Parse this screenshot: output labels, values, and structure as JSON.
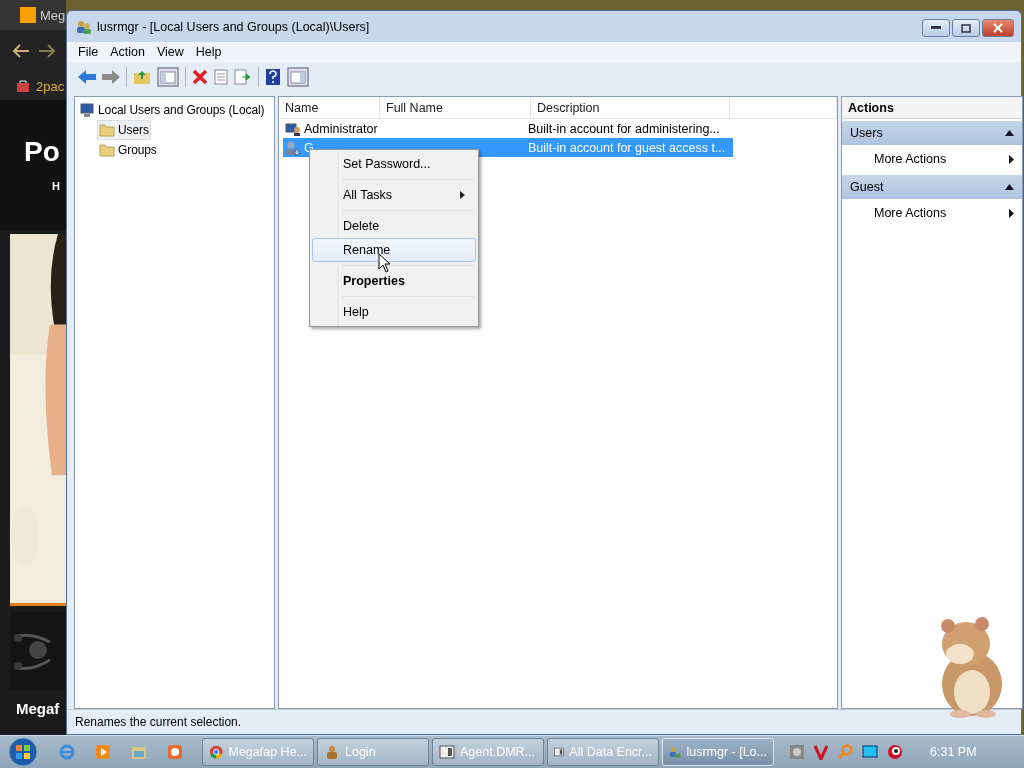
{
  "browser": {
    "tab_title": "Meg",
    "bookmark": "2pac",
    "heading": "Po",
    "nav_item": "H",
    "video_title": "Megaf"
  },
  "window": {
    "title": "lusrmgr - [Local Users and Groups (Local)\\Users]"
  },
  "menu": [
    "File",
    "Action",
    "View",
    "Help"
  ],
  "tree": [
    {
      "label": "Local Users and Groups (Local)",
      "kind": "computer",
      "selected": false,
      "children": [
        {
          "label": "Users",
          "kind": "folder",
          "selected": true
        },
        {
          "label": "Groups",
          "kind": "folder",
          "selected": false
        }
      ]
    }
  ],
  "list": {
    "columns": [
      "Name",
      "Full Name",
      "Description"
    ],
    "rows": [
      {
        "name": "Administrator",
        "kind": "admin",
        "description": "Built-in account for administering...",
        "selected": false
      },
      {
        "name": "G",
        "kind": "guest",
        "description": "Built-in account for guest access t...",
        "selected": true
      }
    ]
  },
  "context_menu": [
    {
      "label": "Set Password...",
      "kind": "item",
      "bold": false,
      "selected": false
    },
    {
      "label": "All Tasks",
      "kind": "submenu",
      "bold": false,
      "selected": false
    },
    {
      "label": "Delete",
      "kind": "item",
      "bold": false,
      "selected": false
    },
    {
      "label": "Rename",
      "kind": "item",
      "bold": false,
      "selected": true
    },
    {
      "label": "Properties",
      "kind": "item",
      "bold": true,
      "selected": false
    },
    {
      "label": "Help",
      "kind": "item",
      "bold": false,
      "selected": false
    }
  ],
  "actions": {
    "title": "Actions",
    "sections": [
      {
        "title": "Users",
        "items": [
          "More Actions"
        ]
      },
      {
        "title": "Guest",
        "items": [
          "More Actions"
        ]
      }
    ]
  },
  "status_bar": "Renames the current selection.",
  "taskbar": {
    "items": [
      {
        "label": "Megafap He...",
        "kind": "chrome",
        "selected": false
      },
      {
        "label": "Login",
        "kind": "app",
        "selected": false
      },
      {
        "label": "Agent.DMR...",
        "kind": "window",
        "selected": false
      },
      {
        "label": "All Data Encr...",
        "kind": "window",
        "selected": false
      },
      {
        "label": "lusrmgr - [Lo...",
        "kind": "users",
        "selected": true
      }
    ],
    "clock": "6:31 PM"
  }
}
